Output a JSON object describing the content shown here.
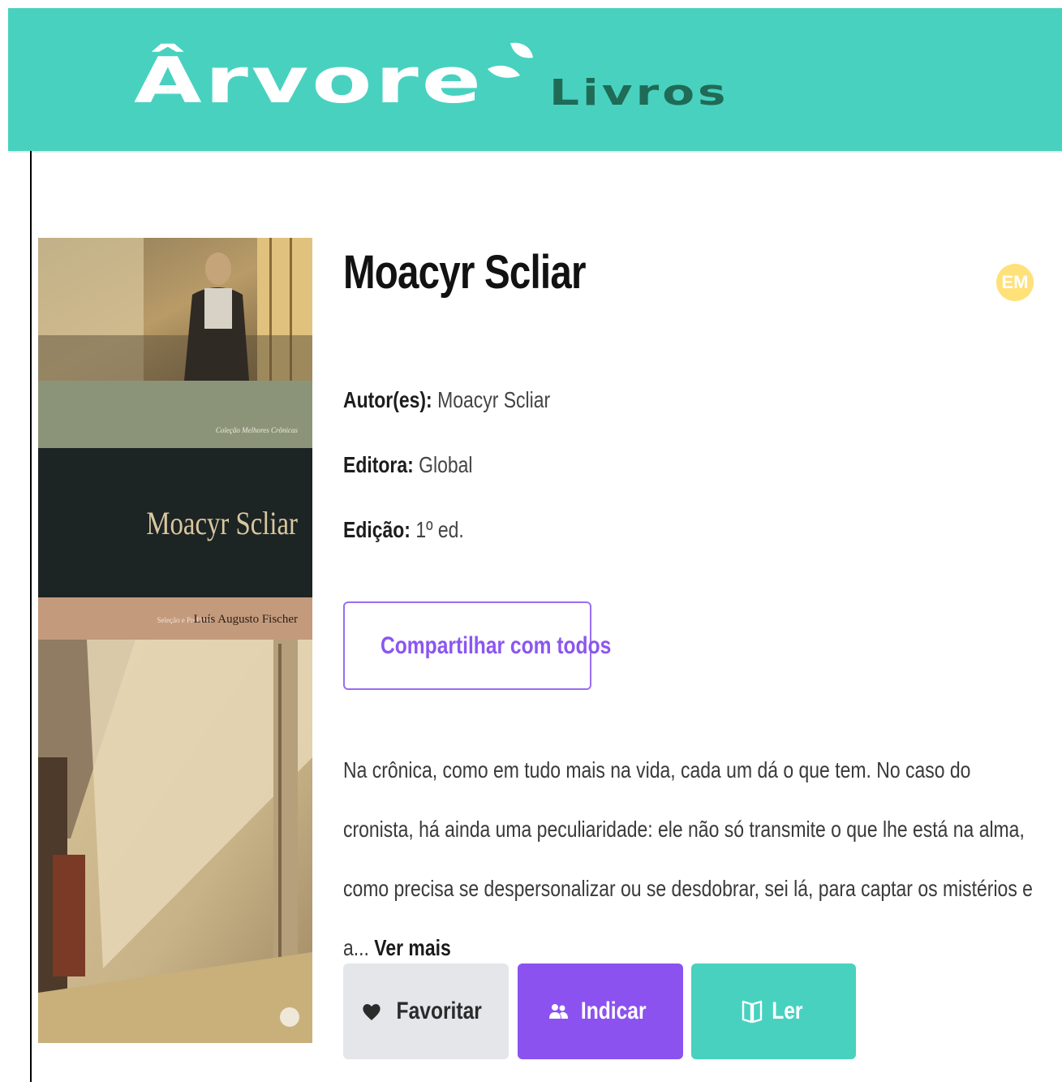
{
  "header": {
    "logo_main": "Ârvore",
    "logo_sub": "Livros"
  },
  "book": {
    "title": "Moacyr Scliar",
    "level_badge": "EM",
    "cover": {
      "collection": "Coleção Melhores Crônicas",
      "author": "Moacyr Scliar",
      "selection_label": "Seleção e Prefácio",
      "selector": "Luís Augusto Fischer"
    },
    "meta": {
      "authors_label": "Autor(es):",
      "authors_value": "Moacyr Scliar",
      "publisher_label": "Editora:",
      "publisher_value": "Global",
      "edition_label": "Edição:",
      "edition_value": "1º ed."
    },
    "share_label": "Compartilhar com todos",
    "description": "Na crônica, como em tudo mais na vida, cada um dá o que tem. No caso do cronista, há ainda uma peculiaridade: ele não só transmite o que lhe está na alma, como precisa se despersonalizar ou se desdobrar, sei lá, para captar os mistérios e a...",
    "see_more": "Ver mais"
  },
  "actions": {
    "favorite": "Favoritar",
    "recommend": "Indicar",
    "read": "Ler"
  },
  "colors": {
    "header_bg": "#49d1c0",
    "logo_sub": "#1f6b56",
    "accent_purple": "#8b52f0",
    "accent_teal": "#49d1c0",
    "badge_yellow": "#ffe17a"
  }
}
